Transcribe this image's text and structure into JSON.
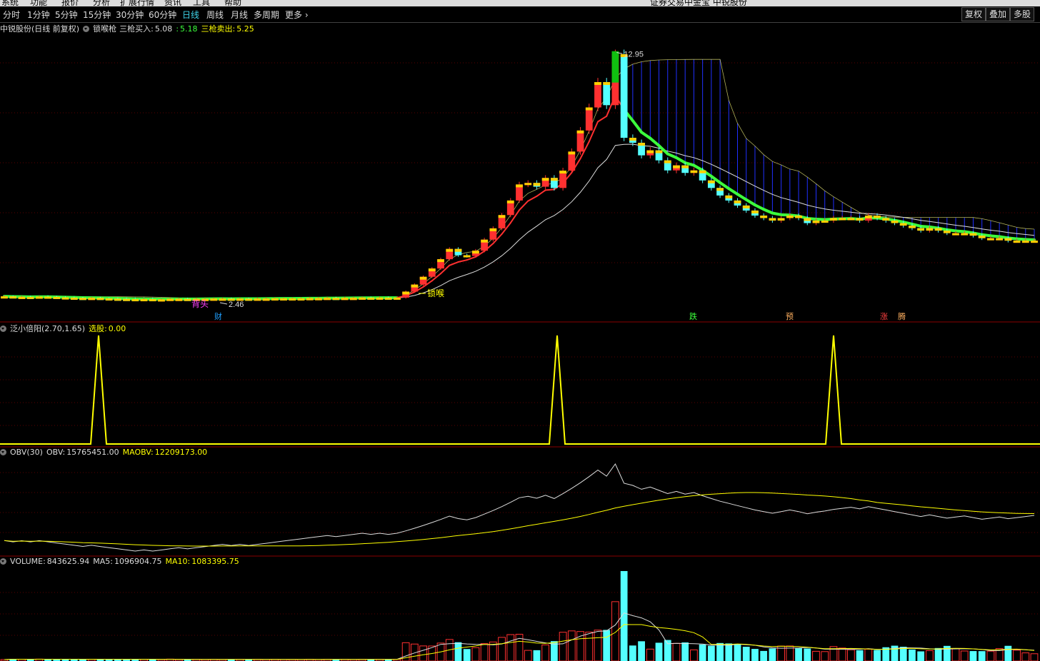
{
  "menu": {
    "items": [
      "系统",
      "功能",
      "报价",
      "分析",
      "扩展行情",
      "资讯",
      "工具",
      "帮助"
    ],
    "center": "证券交易中金宝 中锐股份"
  },
  "toolbar": {
    "periods": [
      "分时",
      "1分钟",
      "5分钟",
      "15分钟",
      "30分钟",
      "60分钟",
      "日线",
      "周线",
      "月线",
      "多周期",
      "更多"
    ],
    "active": "日线",
    "right_buttons": [
      "复权",
      "叠加",
      "多股"
    ]
  },
  "panels": {
    "price": {
      "stock": "中锐股份(日线 前复权)",
      "indicator": "锁喉枪",
      "buy_label": "三枪买入:",
      "buy_value": "5.08",
      "mid_value": "5.18",
      "sell_label": "三枪卖出:",
      "sell_value": "5.25",
      "high_label": "12.95",
      "low_label": "2.46",
      "lock_label": "锁喉",
      "signals": {
        "cai": "财",
        "die": "跌",
        "yu": "预",
        "zhang": "涨",
        "teng": "腾",
        "bei": "背头"
      }
    },
    "signal": {
      "name": "泛小倍阳(2.70,1.65)",
      "label": "选股:",
      "value": "0.00"
    },
    "obv": {
      "name": "OBV(30)",
      "obv_label": "OBV:",
      "obv_value": "15765451.00",
      "ma_label": "MAOBV:",
      "ma_value": "12209173.00"
    },
    "volume": {
      "name": "VOLUME:",
      "vol_value": "843625.94",
      "ma5_label": "MA5:",
      "ma5_value": "1096904.75",
      "ma10_label": "MA10:",
      "ma10_value": "1083395.75"
    }
  },
  "colors": {
    "up": "#ff3030",
    "down": "#54ffff",
    "yellow": "#ffff00",
    "white": "#dcdcdc",
    "green": "#3cff3c",
    "blue": "#2030ff",
    "grid": "#5a0000"
  },
  "chart_data": {
    "type": "candlestick",
    "close": [
      2.58,
      2.55,
      2.56,
      2.55,
      2.57,
      2.56,
      2.54,
      2.53,
      2.52,
      2.51,
      2.52,
      2.5,
      2.49,
      2.48,
      2.47,
      2.46,
      2.47,
      2.46,
      2.46,
      2.48,
      2.48,
      2.47,
      2.48,
      2.48,
      2.49,
      2.49,
      2.48,
      2.49,
      2.48,
      2.49,
      2.49,
      2.5,
      2.5,
      2.5,
      2.5,
      2.51,
      2.51,
      2.52,
      2.51,
      2.52,
      2.52,
      2.53,
      2.52,
      2.53,
      2.52,
      2.53,
      2.77,
      3.05,
      3.36,
      3.69,
      4.06,
      4.47,
      4.22,
      4.19,
      4.4,
      4.84,
      5.29,
      5.82,
      6.4,
      7.04,
      7.1,
      6.95,
      7.3,
      6.9,
      7.59,
      8.35,
      9.19,
      10.11,
      11.12,
      10.2,
      12.23,
      8.9,
      8.7,
      8.2,
      8.4,
      8.0,
      7.6,
      7.8,
      7.5,
      7.6,
      7.2,
      6.9,
      6.6,
      6.4,
      6.2,
      6.0,
      5.8,
      5.7,
      5.6,
      5.7,
      5.8,
      5.7,
      5.5,
      5.6,
      5.6,
      5.7,
      5.7,
      5.7,
      5.6,
      5.8,
      5.7,
      5.6,
      5.5,
      5.4,
      5.3,
      5.2,
      5.3,
      5.2,
      5.1,
      5.1,
      5.1,
      5.0,
      4.9,
      4.9,
      4.9,
      4.8,
      4.8,
      4.8,
      4.8
    ]
  }
}
